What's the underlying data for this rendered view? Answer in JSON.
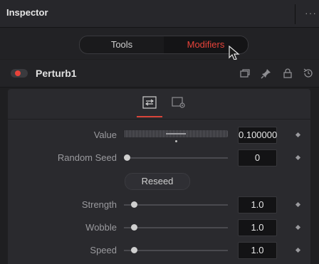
{
  "window": {
    "title": "Inspector"
  },
  "toolbar": {
    "tools_label": "Tools",
    "modifiers_label": "Modifiers"
  },
  "node": {
    "name": "Perturb1"
  },
  "colors": {
    "accent": "#e8433a",
    "panel": "#2a2a2e"
  },
  "params": {
    "value": {
      "label": "Value",
      "field": "0.100000"
    },
    "seed": {
      "label": "Random Seed",
      "field": "0",
      "slider": 0.0
    },
    "reseed_label": "Reseed",
    "strength": {
      "label": "Strength",
      "field": "1.0",
      "slider": 0.1
    },
    "wobble": {
      "label": "Wobble",
      "field": "1.0",
      "slider": 0.1
    },
    "speed": {
      "label": "Speed",
      "field": "1.0",
      "slider": 0.1
    }
  },
  "icons": [
    "options-menu-icon",
    "node-version-icon",
    "pin-icon",
    "lock-icon",
    "reset-icon",
    "controls-tab-icon",
    "settings-tab-icon",
    "arrow-cursor-icon"
  ]
}
